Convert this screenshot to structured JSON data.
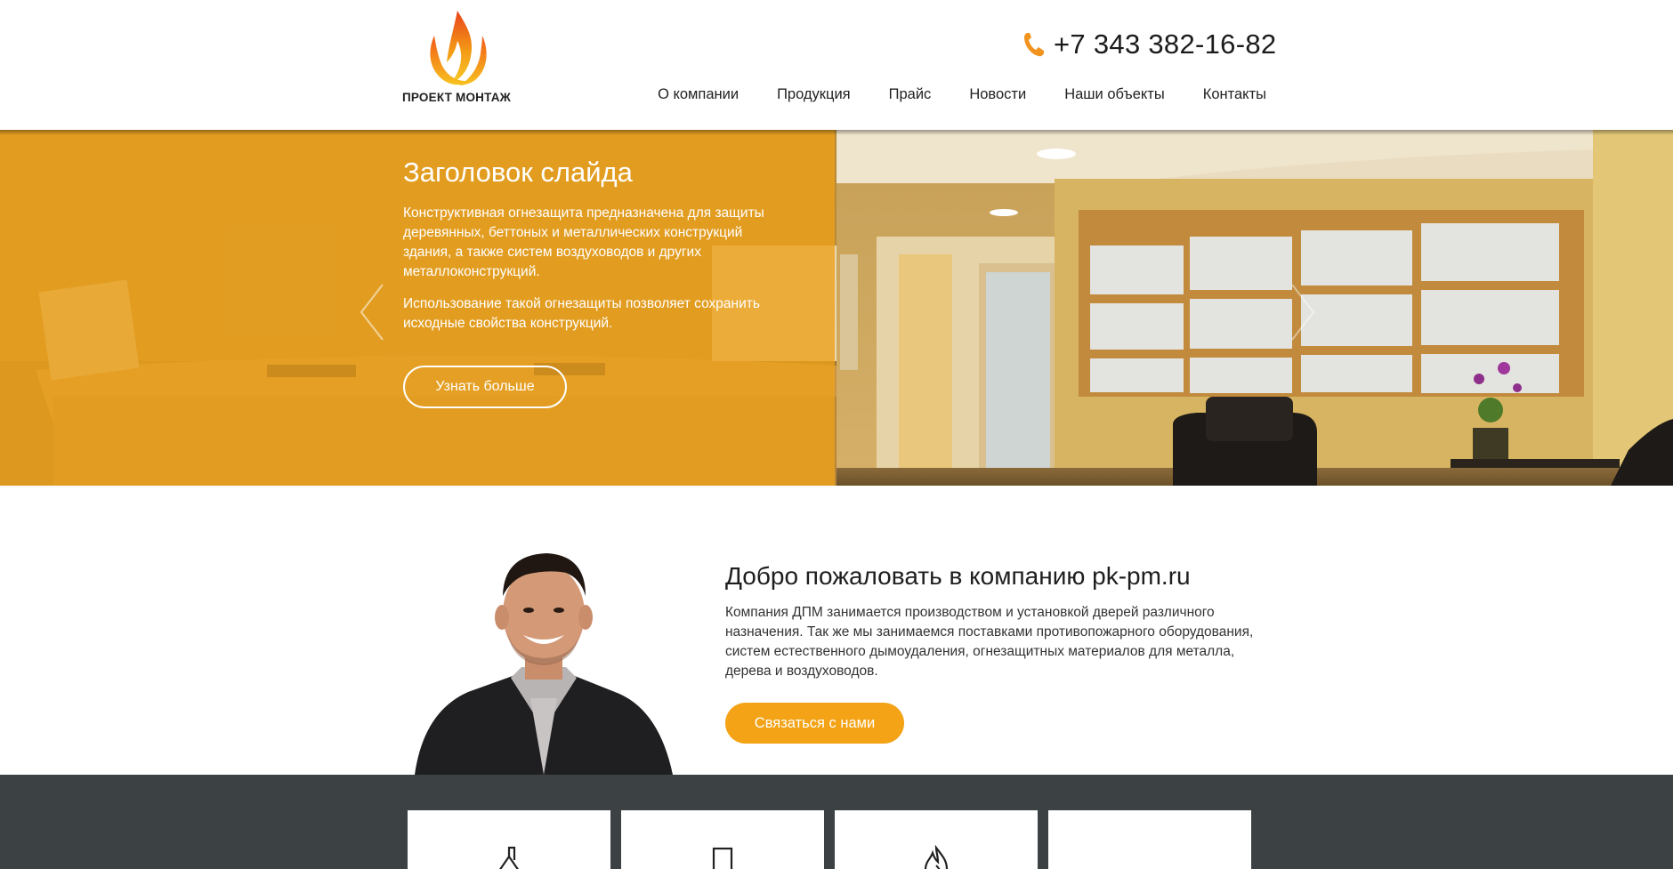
{
  "brand": {
    "name": "ПРОЕКТ МОНТАЖ",
    "logo_icon": "flame-logo",
    "accent_color": "#f3a315"
  },
  "header": {
    "phone_icon": "phone-icon",
    "phone": "+7 343 382-16-82"
  },
  "nav": {
    "items": [
      {
        "label": "О компании"
      },
      {
        "label": "Продукция"
      },
      {
        "label": "Прайс"
      },
      {
        "label": "Новости"
      },
      {
        "label": "Наши объекты"
      },
      {
        "label": "Контакты"
      }
    ]
  },
  "slider": {
    "title": "Заголовок слайда",
    "paragraphs": [
      "Конструктивная огнезащита предназначена для защиты деревянных, беттоных и металлических конструкций здания, а также систем воздуховодов и других металлоконструкций.",
      "Использование такой огнезащиты позволяет сохранить исходные свойства конструкций."
    ],
    "button_label": "Узнать больше",
    "prev_icon": "chevron-left-icon",
    "next_icon": "chevron-right-icon"
  },
  "welcome": {
    "title": "Добро пожаловать в компанию pk-pm.ru",
    "body": "Компания ДПМ занимается производством и установкой дверей различного назначения. Так же мы занимаемся поставками противопожарного оборудования, систем естественного дымоудаления, огнезащитных материалов для металла, дерева и воздуховодов.",
    "button_label": "Связаться с нами"
  },
  "features": {
    "icons": [
      "roof-icon",
      "door-icon",
      "fire-icon",
      "blank"
    ]
  }
}
